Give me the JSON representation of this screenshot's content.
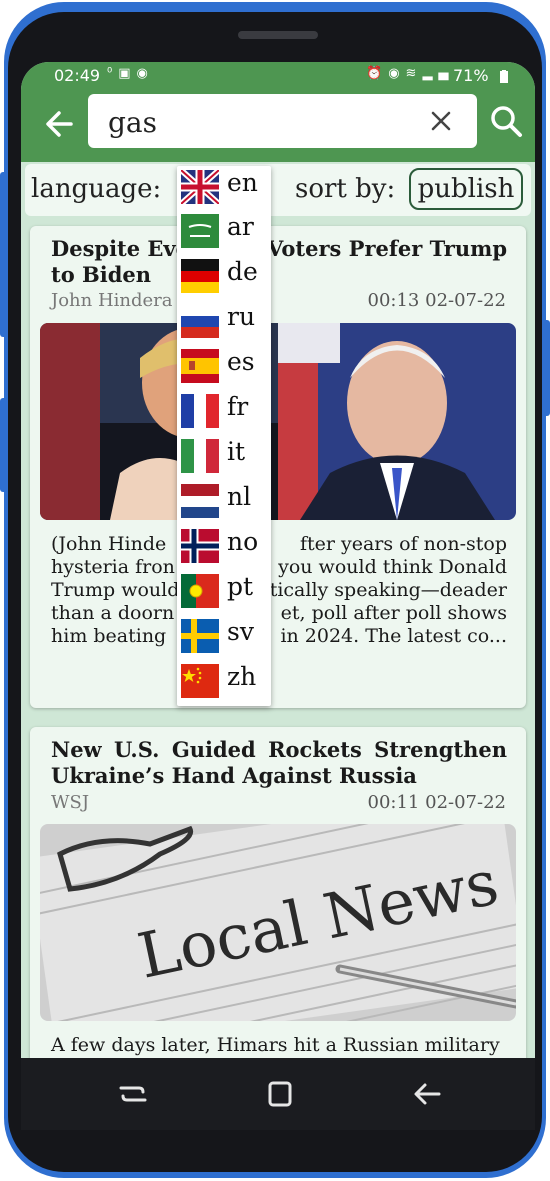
{
  "status_bar": {
    "time": "02:49",
    "left_icons": [
      "data-speed-icon",
      "image-icon",
      "location-icon"
    ],
    "right_icons": [
      "alarm-icon",
      "location-icon",
      "wifi-icon",
      "signal-icon"
    ],
    "battery": "71%"
  },
  "search": {
    "query": "gas"
  },
  "filters": {
    "language_label": "language:",
    "sort_label": "sort by:",
    "sort_value": "publish"
  },
  "language_dropdown": {
    "items": [
      {
        "code": "en",
        "flag": "uk-flag-icon"
      },
      {
        "code": "ar",
        "flag": "saudi-flag-icon"
      },
      {
        "code": "de",
        "flag": "germany-flag-icon"
      },
      {
        "code": "ru",
        "flag": "russia-flag-icon"
      },
      {
        "code": "es",
        "flag": "spain-flag-icon"
      },
      {
        "code": "fr",
        "flag": "france-flag-icon"
      },
      {
        "code": "it",
        "flag": "italy-flag-icon"
      },
      {
        "code": "nl",
        "flag": "netherlands-flag-icon"
      },
      {
        "code": "no",
        "flag": "norway-flag-icon"
      },
      {
        "code": "pt",
        "flag": "portugal-flag-icon"
      },
      {
        "code": "sv",
        "flag": "sweden-flag-icon"
      },
      {
        "code": "zh",
        "flag": "china-flag-icon"
      }
    ]
  },
  "articles": [
    {
      "title_line1": "Despite Eve",
      "title_line1_right": "Voters Prefer Trump",
      "title_line2": "to Biden",
      "source": "John Hindera",
      "time": "00:13 02-07-22",
      "desc_lines": [
        [
          "(John Hinde",
          "fter years of non-stop"
        ],
        [
          "hysteria fron",
          "you would think Donald"
        ],
        [
          "Trump would",
          "tically speaking—deader"
        ],
        [
          "than a doorn",
          "et, poll after poll shows"
        ],
        [
          "him beating",
          "in 2024. The latest co..."
        ]
      ]
    },
    {
      "title": "New U.S. Guided Rockets Strengthen Ukraine’s Hand Against Russia",
      "source": "WSJ",
      "time": "00:11 02-07-22",
      "image_text": "Local News",
      "desc": "A few days later, Himars hit a Russian military"
    }
  ],
  "colors": {
    "app_green": "#4e9651",
    "screen_bg": "#cfe7d6",
    "card_bg": "#eef7f0",
    "phone_frame": "#2f6fd0"
  }
}
